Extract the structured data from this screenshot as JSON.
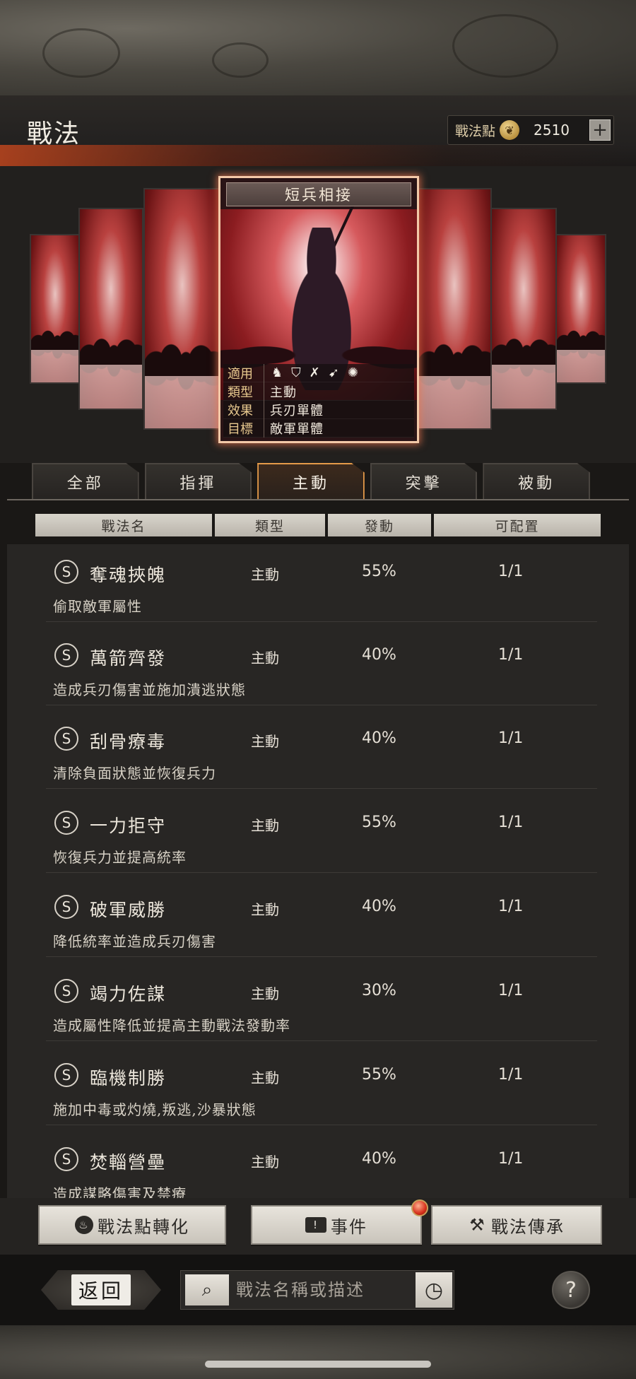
{
  "header": {
    "title": "戰法",
    "points_label": "戰法點",
    "points_value": "2510",
    "plus_label": "+"
  },
  "featured_card": {
    "title": "短兵相接",
    "rows": [
      {
        "key": "適用",
        "value": ""
      },
      {
        "key": "類型",
        "value": "主動"
      },
      {
        "key": "效果",
        "value": "兵刃單體"
      },
      {
        "key": "目標",
        "value": "敵軍單體"
      }
    ],
    "unit_icons": [
      "cavalry-icon",
      "shield-icon",
      "bow-icon",
      "spear-icon",
      "wheel-icon"
    ]
  },
  "tabs": [
    {
      "label": "全部",
      "active": false
    },
    {
      "label": "指揮",
      "active": false
    },
    {
      "label": "主動",
      "active": true
    },
    {
      "label": "突擊",
      "active": false
    },
    {
      "label": "被動",
      "active": false
    }
  ],
  "table_headers": [
    "戰法名",
    "類型",
    "發動",
    "可配置"
  ],
  "tactics": [
    {
      "grade": "S",
      "name": "奪魂挾魄",
      "type": "主動",
      "rate": "55%",
      "config": "1/1",
      "desc": "偷取敵軍屬性"
    },
    {
      "grade": "S",
      "name": "萬箭齊發",
      "type": "主動",
      "rate": "40%",
      "config": "1/1",
      "desc": "造成兵刃傷害並施加潰逃狀態"
    },
    {
      "grade": "S",
      "name": "刮骨療毒",
      "type": "主動",
      "rate": "40%",
      "config": "1/1",
      "desc": "清除負面狀態並恢復兵力"
    },
    {
      "grade": "S",
      "name": "一力拒守",
      "type": "主動",
      "rate": "55%",
      "config": "1/1",
      "desc": "恢復兵力並提高統率"
    },
    {
      "grade": "S",
      "name": "破軍威勝",
      "type": "主動",
      "rate": "40%",
      "config": "1/1",
      "desc": "降低統率並造成兵刃傷害"
    },
    {
      "grade": "S",
      "name": "竭力佐謀",
      "type": "主動",
      "rate": "30%",
      "config": "1/1",
      "desc": "造成屬性降低並提高主動戰法發動率"
    },
    {
      "grade": "S",
      "name": "臨機制勝",
      "type": "主動",
      "rate": "55%",
      "config": "1/1",
      "desc": "施加中毒或灼燒,叛逃,沙暴狀態"
    },
    {
      "grade": "S",
      "name": "焚輜營壘",
      "type": "主動",
      "rate": "40%",
      "config": "1/1",
      "desc": "造成謀略傷害及禁療"
    }
  ],
  "buttons": {
    "convert": "戰法點轉化",
    "events": "事件",
    "inherit": "戰法傳承"
  },
  "nav": {
    "back": "返回",
    "search_placeholder": "戰法名稱或描述",
    "help": "?"
  },
  "colors": {
    "accent_tab_border": "#e49a49",
    "card_glow": "#f3c9a8",
    "notif_red": "#d6301c"
  }
}
